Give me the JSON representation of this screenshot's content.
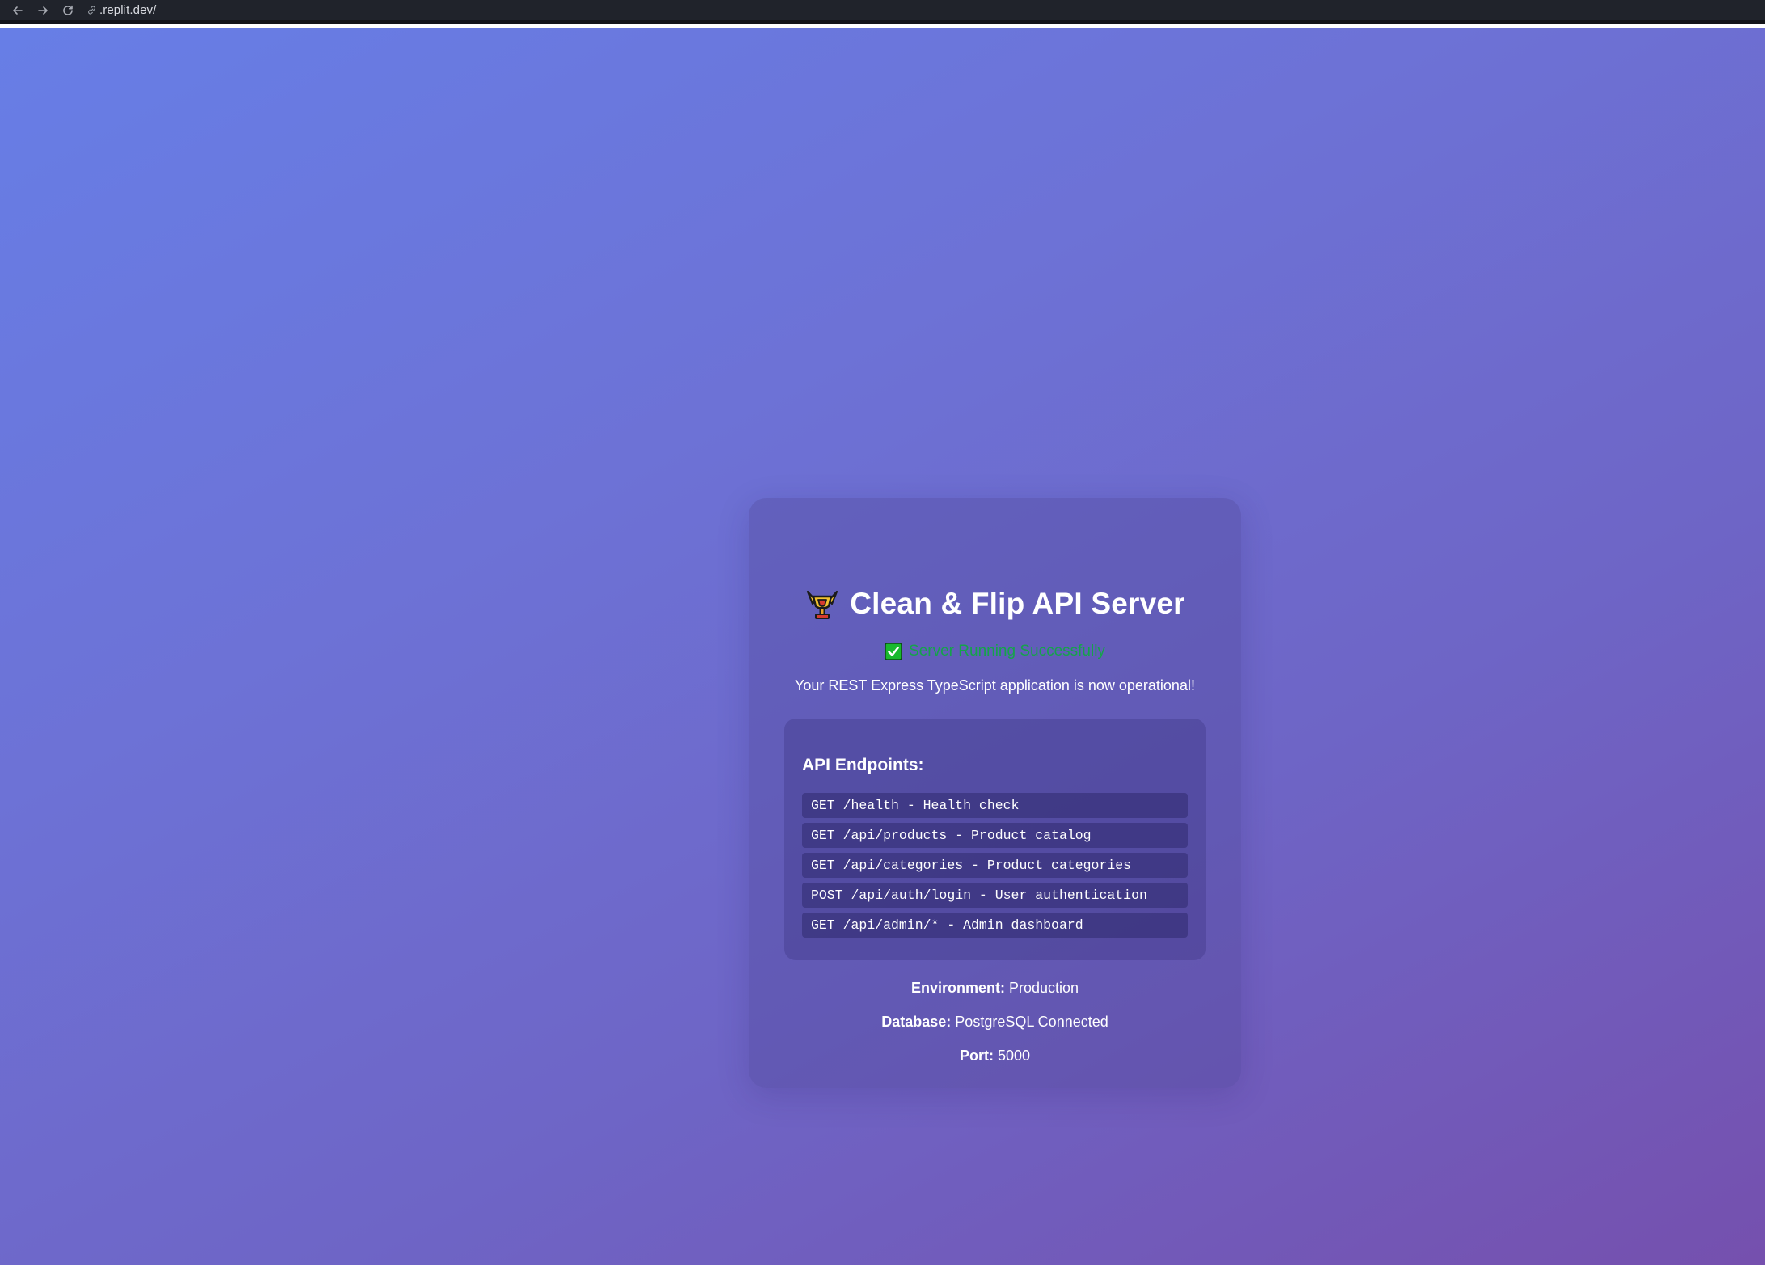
{
  "browser": {
    "back_icon": "arrow-left-icon",
    "forward_icon": "arrow-right-icon",
    "reload_icon": "reload-icon",
    "url": ".replit.dev/"
  },
  "card": {
    "title": "Clean & Flip API Server",
    "title_icon": "trophy-icon",
    "status_icon": "check-box-icon",
    "status": "Server Running Successfully",
    "subtitle": "Your REST Express TypeScript application is now operational!",
    "endpoints_heading": "API Endpoints:",
    "endpoints": [
      "GET /health - Health check",
      "GET /api/products - Product catalog",
      "GET /api/categories - Product categories",
      "POST /api/auth/login - User authentication",
      "GET /api/admin/* - Admin dashboard"
    ],
    "environment": {
      "label": "Environment:",
      "value": "Production"
    },
    "database": {
      "label": "Database:",
      "value": "PostgreSQL Connected"
    },
    "port": {
      "label": "Port:",
      "value": "5000"
    }
  },
  "colors": {
    "status_green": "#15a34a",
    "gradient_start": "#677ee6",
    "gradient_end": "#7550ae"
  }
}
